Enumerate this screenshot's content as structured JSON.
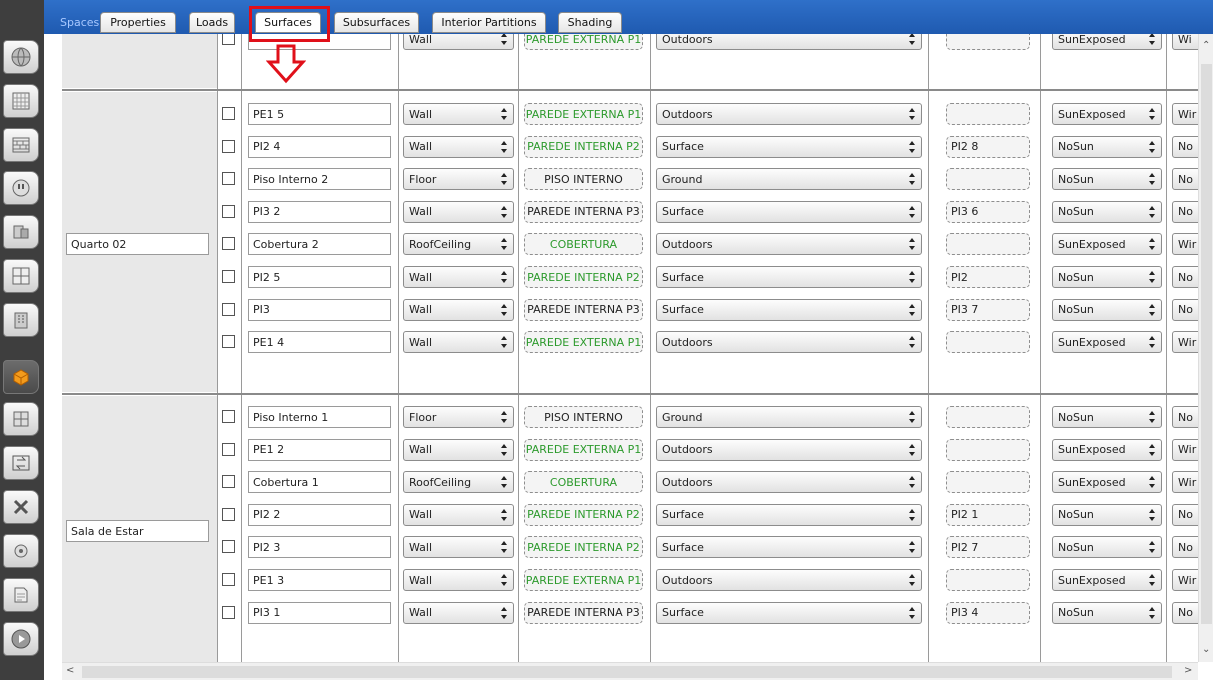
{
  "tabs": {
    "spaces": "Spaces",
    "items": [
      "Properties",
      "Loads",
      "Surfaces",
      "Subsurfaces",
      "Interior Partitions",
      "Shading"
    ],
    "selected": "Surfaces"
  },
  "colors": {
    "highlight": "#e0101a",
    "tab_bar": "#2463bd",
    "construction_green": "#2c9a2c"
  },
  "nav_icons": [
    "globe-icon",
    "schedule-icon",
    "constructions-icon",
    "loads-icon",
    "space-types-icon",
    "geometry-icon",
    "facility-icon",
    "spaces-icon",
    "thermal-zones-icon",
    "hvac-icon",
    "measures-icon",
    "simulation-settings-icon",
    "reports-icon",
    "run-icon"
  ],
  "top_partial_row": {
    "type": "Wall",
    "construction": "PAREDE EXTERNA P1",
    "boundary": "Outdoors",
    "sun": "SunExposed",
    "wind": "Wi"
  },
  "groups": [
    {
      "space": "Quarto 02",
      "rows": [
        {
          "name": "PE1 5",
          "type": "Wall",
          "construction": "PAREDE EXTERNA P1",
          "construction_color": "green",
          "boundary": "Outdoors",
          "adjacent": "",
          "sun": "SunExposed",
          "wind": "Wir"
        },
        {
          "name": "PI2 4",
          "type": "Wall",
          "construction": "PAREDE INTERNA P2",
          "construction_color": "green",
          "boundary": "Surface",
          "adjacent": "PI2 8",
          "sun": "NoSun",
          "wind": "No"
        },
        {
          "name": "Piso Interno 2",
          "type": "Floor",
          "construction": "PISO INTERNO",
          "construction_color": "black",
          "boundary": "Ground",
          "adjacent": "",
          "sun": "NoSun",
          "wind": "No"
        },
        {
          "name": "PI3 2",
          "type": "Wall",
          "construction": "PAREDE INTERNA P3",
          "construction_color": "black",
          "boundary": "Surface",
          "adjacent": "PI3 6",
          "sun": "NoSun",
          "wind": "No"
        },
        {
          "name": "Cobertura 2",
          "type": "RoofCeiling",
          "construction": "COBERTURA",
          "construction_color": "green",
          "boundary": "Outdoors",
          "adjacent": "",
          "sun": "SunExposed",
          "wind": "Wir"
        },
        {
          "name": "PI2 5",
          "type": "Wall",
          "construction": "PAREDE INTERNA P2",
          "construction_color": "green",
          "boundary": "Surface",
          "adjacent": "PI2",
          "sun": "NoSun",
          "wind": "No"
        },
        {
          "name": "PI3",
          "type": "Wall",
          "construction": "PAREDE INTERNA P3",
          "construction_color": "black",
          "boundary": "Surface",
          "adjacent": "PI3 7",
          "sun": "NoSun",
          "wind": "No"
        },
        {
          "name": "PE1 4",
          "type": "Wall",
          "construction": "PAREDE EXTERNA P1",
          "construction_color": "green",
          "boundary": "Outdoors",
          "adjacent": "",
          "sun": "SunExposed",
          "wind": "Wir"
        }
      ]
    },
    {
      "space": "Sala de Estar",
      "rows": [
        {
          "name": "Piso Interno 1",
          "type": "Floor",
          "construction": "PISO INTERNO",
          "construction_color": "black",
          "boundary": "Ground",
          "adjacent": "",
          "sun": "NoSun",
          "wind": "No"
        },
        {
          "name": "PE1 2",
          "type": "Wall",
          "construction": "PAREDE EXTERNA P1",
          "construction_color": "green",
          "boundary": "Outdoors",
          "adjacent": "",
          "sun": "SunExposed",
          "wind": "Wir"
        },
        {
          "name": "Cobertura 1",
          "type": "RoofCeiling",
          "construction": "COBERTURA",
          "construction_color": "green",
          "boundary": "Outdoors",
          "adjacent": "",
          "sun": "SunExposed",
          "wind": "Wir"
        },
        {
          "name": "PI2 2",
          "type": "Wall",
          "construction": "PAREDE INTERNA P2",
          "construction_color": "green",
          "boundary": "Surface",
          "adjacent": "PI2 1",
          "sun": "NoSun",
          "wind": "No"
        },
        {
          "name": "PI2 3",
          "type": "Wall",
          "construction": "PAREDE INTERNA P2",
          "construction_color": "green",
          "boundary": "Surface",
          "adjacent": "PI2 7",
          "sun": "NoSun",
          "wind": "No"
        },
        {
          "name": "PE1 3",
          "type": "Wall",
          "construction": "PAREDE EXTERNA P1",
          "construction_color": "green",
          "boundary": "Outdoors",
          "adjacent": "",
          "sun": "SunExposed",
          "wind": "Wir"
        },
        {
          "name": "PI3 1",
          "type": "Wall",
          "construction": "PAREDE INTERNA P3",
          "construction_color": "black",
          "boundary": "Surface",
          "adjacent": "PI3 4",
          "sun": "NoSun",
          "wind": "No"
        }
      ]
    }
  ]
}
